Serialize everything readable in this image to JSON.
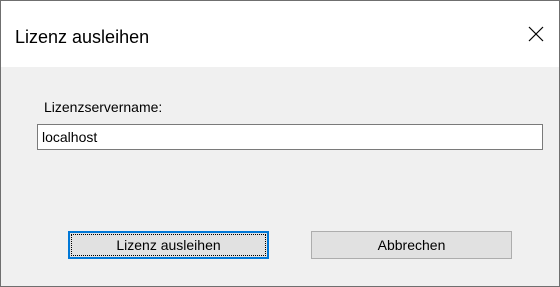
{
  "window": {
    "title": "Lizenz ausleihen",
    "close_icon": "close-icon"
  },
  "form": {
    "server_label": "Lizenzservername:",
    "server_value": "localhost"
  },
  "buttons": {
    "borrow_label": "Lizenz ausleihen",
    "cancel_label": "Abbrechen"
  },
  "colors": {
    "accent": "#0078d7",
    "dialog_background": "#f0f0f0",
    "titlebar_background": "#ffffff"
  }
}
